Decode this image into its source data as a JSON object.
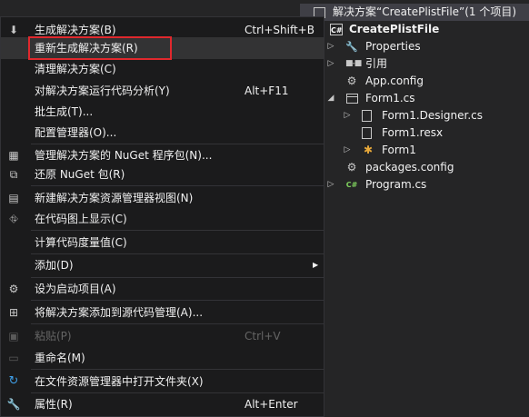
{
  "explorer": {
    "solution_title": "解决方案“CreatePlistFile”(1 个项目)",
    "items": [
      {
        "label": "CreatePlistFile",
        "icon": "csharp-project-icon"
      },
      {
        "label": "Properties",
        "icon": "wrench-icon"
      },
      {
        "label": "引用",
        "icon": "references-icon"
      },
      {
        "label": "App.config",
        "icon": "config-file-icon"
      },
      {
        "label": "Form1.cs",
        "icon": "form-icon"
      },
      {
        "label": "Form1.Designer.cs",
        "icon": "code-file-icon"
      },
      {
        "label": "Form1.resx",
        "icon": "resource-file-icon"
      },
      {
        "label": "Form1",
        "icon": "class-icon"
      },
      {
        "label": "packages.config",
        "icon": "config-file-icon"
      },
      {
        "label": "Program.cs",
        "icon": "csharp-file-icon"
      }
    ]
  },
  "menu": {
    "items": [
      {
        "label": "生成解决方案(B)",
        "shortcut": "Ctrl+Shift+B",
        "icon": "build-icon"
      },
      {
        "label": "重新生成解决方案(R)",
        "shortcut": "",
        "icon": ""
      },
      {
        "label": "清理解决方案(C)",
        "shortcut": "",
        "icon": ""
      },
      {
        "label": "对解决方案运行代码分析(Y)",
        "shortcut": "Alt+F11",
        "icon": ""
      },
      {
        "label": "批生成(T)...",
        "shortcut": "",
        "icon": ""
      },
      {
        "label": "配置管理器(O)...",
        "shortcut": "",
        "icon": ""
      },
      {
        "label": "管理解决方案的 NuGet 程序包(N)...",
        "shortcut": "",
        "icon": "nuget-icon"
      },
      {
        "label": "还原 NuGet 包(R)",
        "shortcut": "",
        "icon": "restore-icon"
      },
      {
        "label": "新建解决方案资源管理器视图(N)",
        "shortcut": "",
        "icon": "new-view-icon"
      },
      {
        "label": "在代码图上显示(C)",
        "shortcut": "",
        "icon": "code-map-icon"
      },
      {
        "label": "计算代码度量值(C)",
        "shortcut": "",
        "icon": ""
      },
      {
        "label": "添加(D)",
        "shortcut": "",
        "icon": ""
      },
      {
        "label": "设为启动项目(A)",
        "shortcut": "",
        "icon": "gear-icon"
      },
      {
        "label": "将解决方案添加到源代码管理(A)...",
        "shortcut": "",
        "icon": "source-control-icon"
      },
      {
        "label": "粘贴(P)",
        "shortcut": "Ctrl+V",
        "icon": "paste-icon"
      },
      {
        "label": "重命名(M)",
        "shortcut": "",
        "icon": "rename-icon"
      },
      {
        "label": "在文件资源管理器中打开文件夹(X)",
        "shortcut": "",
        "icon": "refresh-icon"
      },
      {
        "label": "属性(R)",
        "shortcut": "Alt+Enter",
        "icon": "wrench-icon"
      }
    ]
  },
  "colors": {
    "menu_bg": "#1b1b1c",
    "highlight_border": "#e0282d",
    "disabled_text": "#656565"
  }
}
